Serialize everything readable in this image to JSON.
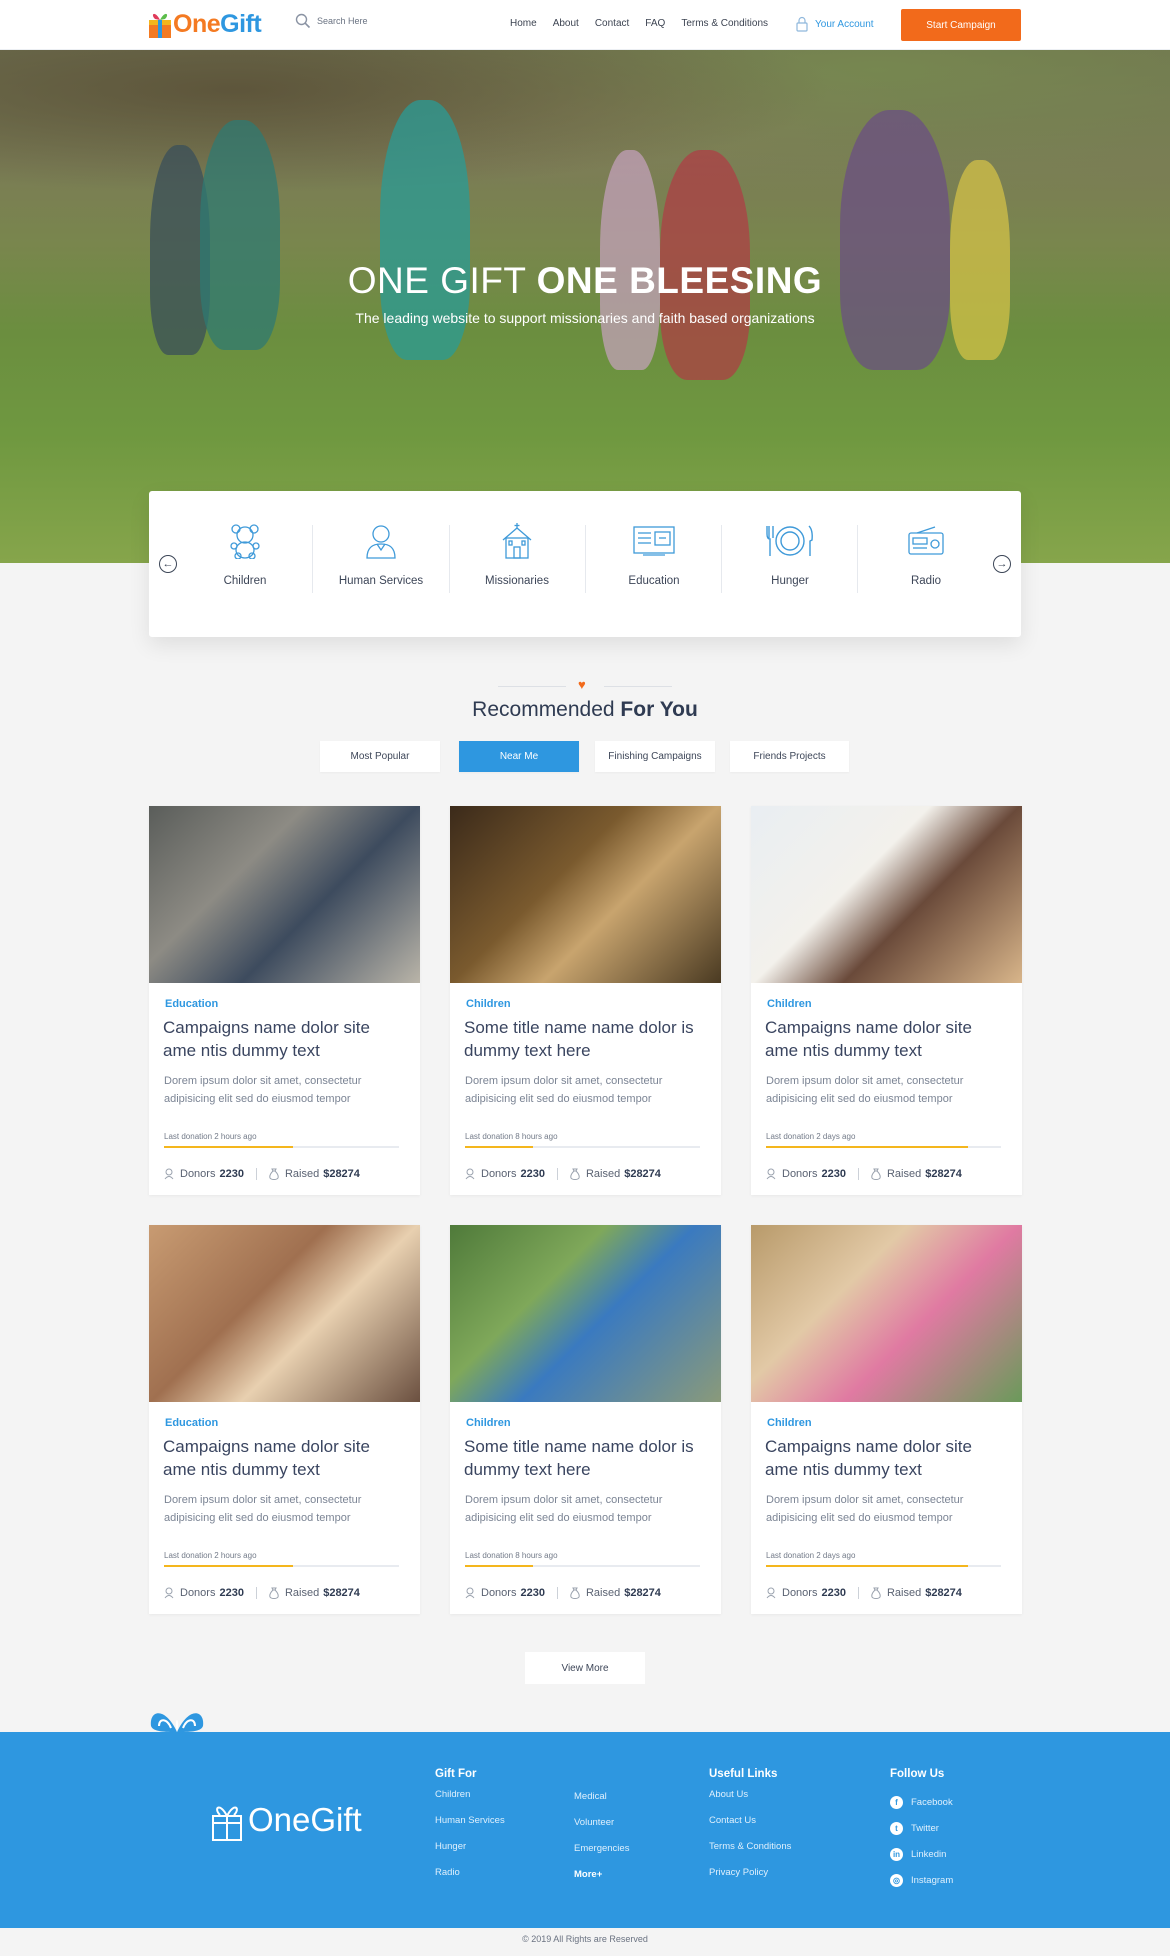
{
  "header": {
    "logo_text_1": "One",
    "logo_text_2": "Gift",
    "search_placeholder": "Search Here",
    "nav": [
      "Home",
      "About",
      "Contact",
      "FAQ",
      "Terms & Conditions"
    ],
    "account": "Your Account",
    "cta": "Start Campaign"
  },
  "hero": {
    "title_light": "ONE GIFT ",
    "title_bold": "ONE BLEESING",
    "subtitle": "The leading website to support missionaries and faith based organizations"
  },
  "categories": [
    "Children",
    "Human Services",
    "Missionaries",
    "Education",
    "Hunger",
    "Radio"
  ],
  "recommended": {
    "title_light": "Recommended ",
    "title_bold": "For You",
    "tabs": [
      "Most Popular",
      "Near Me",
      "Finishing Campaigns",
      "Friends Projects"
    ],
    "active_tab": "Near Me"
  },
  "cards": [
    {
      "category": "Education",
      "title": "Campaigns name dolor site ame ntis dummy text",
      "desc": "Dorem ipsum dolor sit amet, consectetur adipisicing elit sed do eiusmod tempor",
      "last": "Last donation 2 hours ago",
      "progress": 0.55,
      "donors_label": "Donors",
      "donors": "2230",
      "raised_label": "Raised",
      "raised": "$28274"
    },
    {
      "category": "Children",
      "title": "Some title name name dolor is dummy text here",
      "desc": "Dorem ipsum dolor sit amet, consectetur adipisicing elit sed do eiusmod tempor",
      "last": "Last donation 8 hours ago",
      "progress": 0.29,
      "donors_label": "Donors",
      "donors": "2230",
      "raised_label": "Raised",
      "raised": "$28274"
    },
    {
      "category": "Children",
      "title": "Campaigns name dolor site ame ntis dummy text",
      "desc": "Dorem ipsum dolor sit amet, consectetur adipisicing elit sed do eiusmod tempor",
      "last": "Last donation 2 days ago",
      "progress": 0.86,
      "donors_label": "Donors",
      "donors": "2230",
      "raised_label": "Raised",
      "raised": "$28274"
    },
    {
      "category": "Education",
      "title": "Campaigns name dolor site ame ntis dummy text",
      "desc": "Dorem ipsum dolor sit amet, consectetur adipisicing elit sed do eiusmod tempor",
      "last": "Last donation 2 hours ago",
      "progress": 0.55,
      "donors_label": "Donors",
      "donors": "2230",
      "raised_label": "Raised",
      "raised": "$28274"
    },
    {
      "category": "Children",
      "title": "Some title name name dolor is dummy text here",
      "desc": "Dorem ipsum dolor sit amet, consectetur adipisicing elit sed do eiusmod tempor",
      "last": "Last donation 8 hours ago",
      "progress": 0.29,
      "donors_label": "Donors",
      "donors": "2230",
      "raised_label": "Raised",
      "raised": "$28274"
    },
    {
      "category": "Children",
      "title": "Campaigns name dolor site ame ntis dummy text",
      "desc": "Dorem ipsum dolor sit amet, consectetur adipisicing elit sed do eiusmod tempor",
      "last": "Last donation 2 days ago",
      "progress": 0.86,
      "donors_label": "Donors",
      "donors": "2230",
      "raised_label": "Raised",
      "raised": "$28274"
    }
  ],
  "view_more": "View More",
  "footer": {
    "logo": "OneGift",
    "gift_for_title": "Gift For",
    "gift_for_col1": [
      "Children",
      "Human Services",
      "Hunger",
      "Radio"
    ],
    "gift_for_col2": [
      "Medical",
      "Volunteer",
      "Emergencies",
      "More+"
    ],
    "useful_title": "Useful Links",
    "useful": [
      "About Us",
      "Contact Us",
      "Terms & Conditions",
      "Privacy Policy"
    ],
    "follow_title": "Follow Us",
    "follow": [
      "Facebook",
      "Twitter",
      "Linkedin",
      "Instagram"
    ],
    "copyright": "© 2019 All Rights are Reserved"
  },
  "colors": {
    "brand_blue": "#2e97e0",
    "brand_orange": "#f26a1b",
    "progress": "#f4b61d"
  }
}
